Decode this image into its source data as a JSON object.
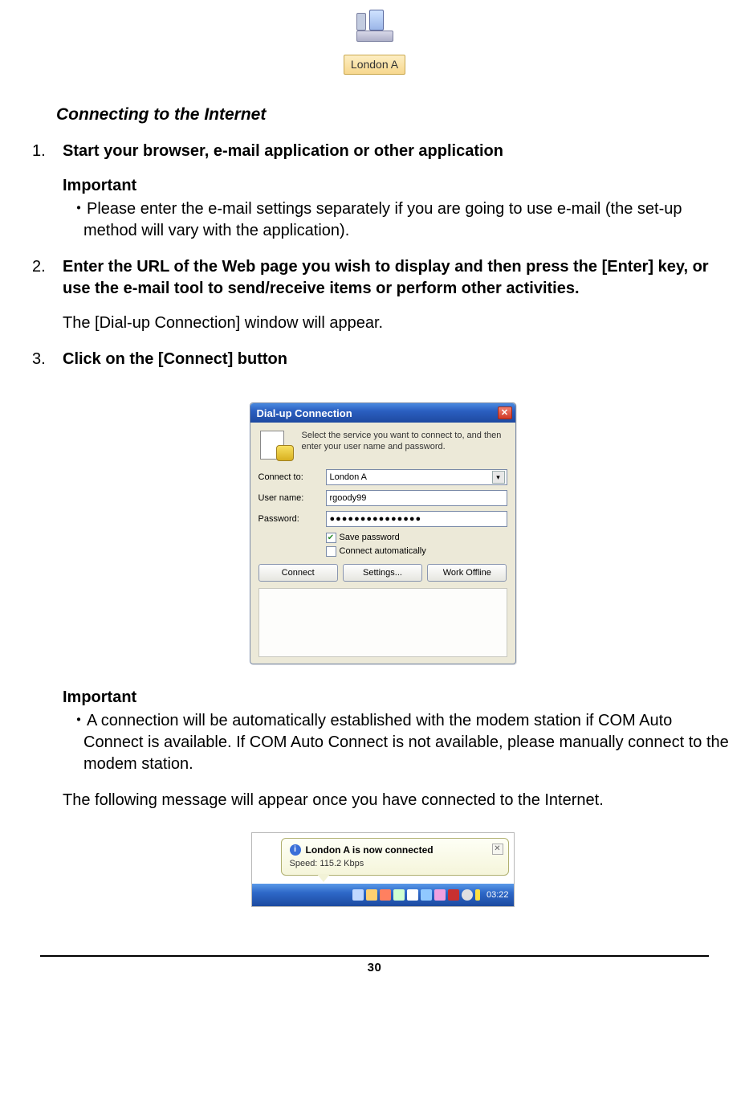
{
  "modem": {
    "label": "London A"
  },
  "sectionTitle": "Connecting to the Internet",
  "steps": {
    "s1": {
      "num": "1.",
      "head": "Start your browser, e-mail application or other application",
      "importantLabel": "Important",
      "note": "・Please enter the e-mail settings separately if you are going to use e-mail (the set-up method will vary with the application)."
    },
    "s2": {
      "num": "2.",
      "head": "Enter the URL of the Web page you wish to display and then press the [Enter] key, or use the e-mail tool to send/receive items or perform other activities.",
      "after": "The [Dial-up Connection] window will appear."
    },
    "s3": {
      "num": "3.",
      "head": "Click on the [Connect] button"
    }
  },
  "dialog": {
    "title": "Dial-up Connection",
    "intro": "Select the service you want to connect to, and then enter your user name and password.",
    "labels": {
      "connectTo": "Connect to:",
      "userName": "User name:",
      "password": "Password:"
    },
    "values": {
      "connectTo": "London A",
      "userName": "rgoody99",
      "password": "●●●●●●●●●●●●●●●"
    },
    "checks": {
      "savePassword": "Save password",
      "autoConnect": "Connect automatically"
    },
    "buttons": {
      "connect": "Connect",
      "settings": "Settings...",
      "workOffline": "Work Offline"
    }
  },
  "afterDialog": {
    "importantLabel": "Important",
    "note": "・A connection will be automatically established with the modem station if COM Auto Connect is available. If COM Auto Connect is not available, please manually connect to the modem station.",
    "following": "The following message will appear once you have connected to the Internet."
  },
  "balloon": {
    "title": "London A is now connected",
    "sub": "Speed: 115.2 Kbps"
  },
  "clock": "03:22",
  "pageNumber": "30"
}
